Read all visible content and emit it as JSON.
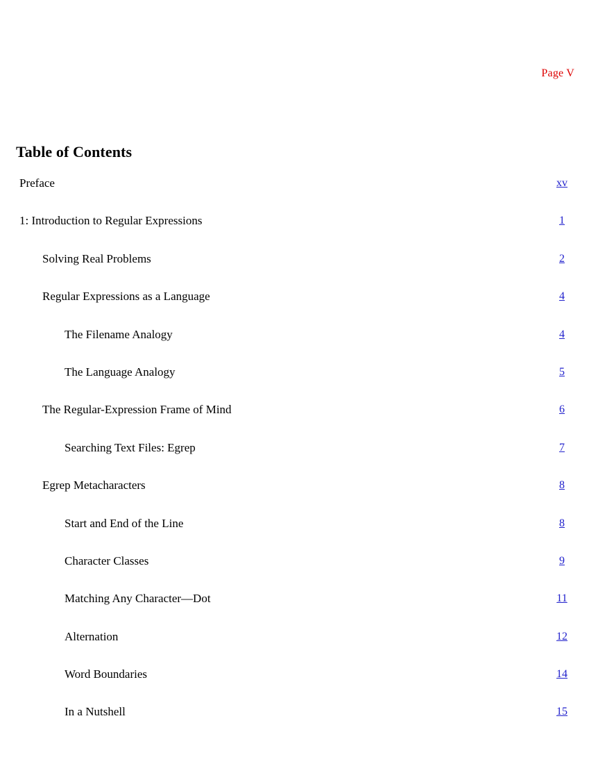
{
  "document": {
    "header_label": "Page V",
    "title": "Table of Contents",
    "header_color": "#dd0000",
    "link_color": "#2020cc",
    "text_color": "#000000",
    "background_color": "#ffffff"
  },
  "toc": {
    "entries": [
      {
        "label": "Preface",
        "page": "xv",
        "level": 0
      },
      {
        "label": "1: Introduction to Regular Expressions",
        "page": "1",
        "level": 0
      },
      {
        "label": "Solving Real Problems",
        "page": "2",
        "level": 1
      },
      {
        "label": "Regular Expressions as a Language",
        "page": "4",
        "level": 1
      },
      {
        "label": "The Filename Analogy",
        "page": "4",
        "level": 2
      },
      {
        "label": "The Language Analogy",
        "page": "5",
        "level": 2
      },
      {
        "label": "The Regular-Expression Frame of Mind",
        "page": "6",
        "level": 1
      },
      {
        "label": "Searching Text Files: Egrep",
        "page": "7",
        "level": 2
      },
      {
        "label": "Egrep Metacharacters",
        "page": "8",
        "level": 1
      },
      {
        "label": "Start and End of the Line",
        "page": "8",
        "level": 2
      },
      {
        "label": "Character Classes",
        "page": "9",
        "level": 2
      },
      {
        "label": "Matching Any Character—Dot",
        "page": "11",
        "level": 2
      },
      {
        "label": "Alternation",
        "page": "12",
        "level": 2
      },
      {
        "label": "Word Boundaries",
        "page": "14",
        "level": 2
      },
      {
        "label": "In a Nutshell",
        "page": "15",
        "level": 2
      }
    ]
  }
}
